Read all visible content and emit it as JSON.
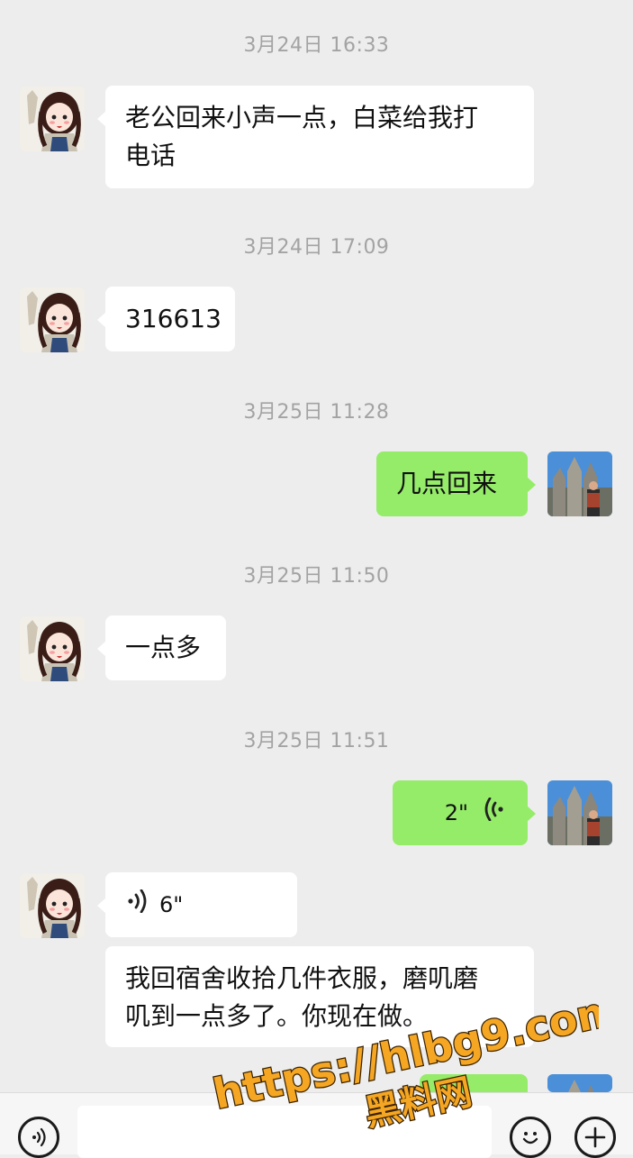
{
  "timestamps": [
    "3月24日 16:33",
    "3月24日 17:09",
    "3月25日 11:28",
    "3月25日 11:50",
    "3月25日 11:51"
  ],
  "messages": [
    {
      "from": "other",
      "line1": "老公回来小声一点，白菜给我打",
      "line2": "电话"
    },
    {
      "from": "other",
      "text": "316613"
    },
    {
      "from": "me",
      "text": "几点回来"
    },
    {
      "from": "other",
      "text": "一点多"
    },
    {
      "from": "me",
      "type": "voice",
      "duration": "2\""
    },
    {
      "from": "other",
      "type": "voice",
      "duration": "6\""
    },
    {
      "from": "other",
      "line1": "我回宿舍收拾几件衣服，磨叽磨",
      "line2": "叽到一点多了。你现在做。"
    }
  ],
  "watermark": {
    "url": "https://hlbg9.com",
    "name": "黑料网",
    "color": "#f5a623"
  },
  "icons": {
    "voice_mode": "voice-input-icon",
    "emoji": "emoji-icon",
    "more": "plus-icon"
  }
}
